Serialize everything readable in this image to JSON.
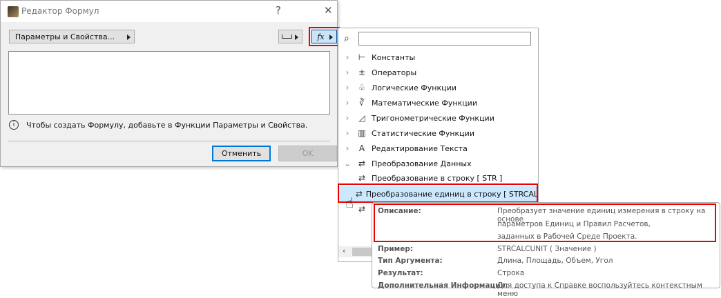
{
  "dialog": {
    "title": "Редактор Формул",
    "help": "?",
    "close": "✕",
    "params_button": "Параметры и Свойства...",
    "fx_label": "fx",
    "info": "Чтобы создать Формулу, добавьте в Функции Параметры и Свойства.",
    "cancel": "Отменить",
    "ok": "OK"
  },
  "panel": {
    "search_placeholder": "",
    "items": [
      {
        "label": "Константы",
        "icon": "constants-icon",
        "glyph": "⊢"
      },
      {
        "label": "Операторы",
        "icon": "operators-icon",
        "glyph": "±"
      },
      {
        "label": "Логические Функции",
        "icon": "puzzle-icon",
        "glyph": "♧"
      },
      {
        "label": "Математические Функции",
        "icon": "root-icon",
        "glyph": "∛"
      },
      {
        "label": "Тригонометрические Функции",
        "icon": "triangle-icon",
        "glyph": "◿"
      },
      {
        "label": "Статистические Функции",
        "icon": "bar-chart-icon",
        "glyph": "▥"
      },
      {
        "label": "Редактирование Текста",
        "icon": "text-icon",
        "glyph": "A"
      },
      {
        "label": "Преобразование Данных",
        "icon": "convert-icon",
        "glyph": "⇄"
      }
    ],
    "children": [
      "Преобразование в строку [ STR ]",
      "Преобразование единиц в строку [ STRCAL"
    ]
  },
  "tooltip": {
    "rows": [
      {
        "label": "Описание:",
        "value": "Преобразует значение единиц измерения в строку на основе"
      },
      {
        "label": "",
        "value": "параметров Единиц и Правил Расчетов,"
      },
      {
        "label": "",
        "value": "заданных в Рабочей Среде Проекта."
      },
      {
        "label": "Пример:",
        "value": "STRCALCUNIT ( Значение )"
      },
      {
        "label": "Тип Аргумента:",
        "value": "Длина, Площадь, Объем, Угол"
      },
      {
        "label": "Результат:",
        "value": "Строка"
      },
      {
        "label": "Дополнительная Информация:",
        "value": "Для доступа к Справке воспользуйтесь контекстным меню"
      }
    ]
  }
}
